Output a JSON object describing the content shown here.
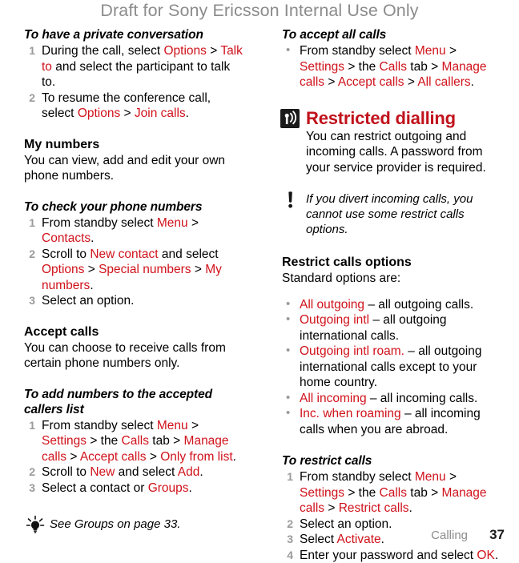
{
  "draft_banner": "Draft for Sony Ericsson Internal Use Only",
  "accent_color": "#d0121b",
  "chapter_color": "#c1121c",
  "muted_color": "#8c8c8c",
  "left_column": {
    "private_conversation": {
      "heading": "To have a private conversation",
      "steps": [
        {
          "parts": [
            {
              "t": "During the call, select ",
              "c": "black"
            },
            {
              "t": "Options",
              "c": "red"
            },
            {
              "t": " > ",
              "c": "black"
            },
            {
              "t": "Talk to",
              "c": "red"
            },
            {
              "t": " and select the participant to talk to.",
              "c": "black"
            }
          ]
        },
        {
          "parts": [
            {
              "t": "To resume the conference call, select ",
              "c": "black"
            },
            {
              "t": "Options",
              "c": "red"
            },
            {
              "t": " > ",
              "c": "black"
            },
            {
              "t": "Join calls",
              "c": "red"
            },
            {
              "t": ".",
              "c": "black"
            }
          ]
        }
      ]
    },
    "my_numbers": {
      "heading": "My numbers",
      "body": "You can view, add and edit your own phone numbers."
    },
    "check_numbers": {
      "heading": "To check your phone numbers",
      "steps": [
        {
          "parts": [
            {
              "t": "From standby select ",
              "c": "black"
            },
            {
              "t": "Menu",
              "c": "red"
            },
            {
              "t": " > ",
              "c": "black"
            },
            {
              "t": "Contacts",
              "c": "red"
            },
            {
              "t": ".",
              "c": "black"
            }
          ]
        },
        {
          "parts": [
            {
              "t": "Scroll to ",
              "c": "black"
            },
            {
              "t": "New contact",
              "c": "red"
            },
            {
              "t": " and select ",
              "c": "black"
            },
            {
              "t": "Options",
              "c": "red"
            },
            {
              "t": " > ",
              "c": "black"
            },
            {
              "t": "Special numbers",
              "c": "red"
            },
            {
              "t": " > ",
              "c": "black"
            },
            {
              "t": "My numbers",
              "c": "red"
            },
            {
              "t": ".",
              "c": "black"
            }
          ]
        },
        {
          "parts": [
            {
              "t": "Select an option.",
              "c": "black"
            }
          ]
        }
      ]
    },
    "accept_calls": {
      "heading": "Accept calls",
      "body": "You can choose to receive calls from certain phone numbers only."
    },
    "add_numbers": {
      "heading": "To add numbers to the accepted callers list",
      "steps": [
        {
          "parts": [
            {
              "t": "From standby select ",
              "c": "black"
            },
            {
              "t": "Menu",
              "c": "red"
            },
            {
              "t": " > ",
              "c": "black"
            },
            {
              "t": "Settings",
              "c": "red"
            },
            {
              "t": " > the ",
              "c": "black"
            },
            {
              "t": "Calls",
              "c": "red"
            },
            {
              "t": " tab > ",
              "c": "black"
            },
            {
              "t": "Manage calls",
              "c": "red"
            },
            {
              "t": " > ",
              "c": "black"
            },
            {
              "t": "Accept calls",
              "c": "red"
            },
            {
              "t": " > ",
              "c": "black"
            },
            {
              "t": "Only from list",
              "c": "red"
            },
            {
              "t": ".",
              "c": "black"
            }
          ]
        },
        {
          "parts": [
            {
              "t": "Scroll to ",
              "c": "black"
            },
            {
              "t": "New",
              "c": "red"
            },
            {
              "t": " and select ",
              "c": "black"
            },
            {
              "t": "Add",
              "c": "red"
            },
            {
              "t": ".",
              "c": "black"
            }
          ]
        },
        {
          "parts": [
            {
              "t": "Select a contact or ",
              "c": "black"
            },
            {
              "t": "Groups",
              "c": "red"
            },
            {
              "t": ".",
              "c": "black"
            }
          ]
        }
      ]
    },
    "tip": {
      "icon": "lightbulb-icon",
      "text": "See Groups on page 33."
    }
  },
  "right_column": {
    "accept_all": {
      "heading": "To accept all calls",
      "bullets": [
        {
          "parts": [
            {
              "t": "From standby select ",
              "c": "black"
            },
            {
              "t": "Menu",
              "c": "red"
            },
            {
              "t": " > ",
              "c": "black"
            },
            {
              "t": "Settings",
              "c": "red"
            },
            {
              "t": " > the ",
              "c": "black"
            },
            {
              "t": "Calls",
              "c": "red"
            },
            {
              "t": " tab > ",
              "c": "black"
            },
            {
              "t": "Manage calls",
              "c": "red"
            },
            {
              "t": " > ",
              "c": "black"
            },
            {
              "t": "Accept calls",
              "c": "red"
            },
            {
              "t": " > ",
              "c": "black"
            },
            {
              "t": "All callers",
              "c": "red"
            },
            {
              "t": ".",
              "c": "black"
            }
          ]
        }
      ]
    },
    "restricted_dialling": {
      "icon": "signal-antenna-icon",
      "title": "Restricted dialling",
      "body": "You can restrict outgoing and incoming calls. A password from your service provider is required."
    },
    "note": {
      "icon": "exclamation-icon",
      "text": "If you divert incoming calls, you cannot use some restrict calls options."
    },
    "restrict_options": {
      "heading": "Restrict calls options",
      "intro": "Standard options are:",
      "items": [
        {
          "parts": [
            {
              "t": "All outgoing",
              "c": "red"
            },
            {
              "t": " – all outgoing calls.",
              "c": "black"
            }
          ]
        },
        {
          "parts": [
            {
              "t": "Outgoing intl",
              "c": "red"
            },
            {
              "t": " – all outgoing international calls.",
              "c": "black"
            }
          ]
        },
        {
          "parts": [
            {
              "t": "Outgoing intl roam.",
              "c": "red"
            },
            {
              "t": " – all outgoing international calls except to your home country.",
              "c": "black"
            }
          ]
        },
        {
          "parts": [
            {
              "t": "All incoming",
              "c": "red"
            },
            {
              "t": " – all incoming calls.",
              "c": "black"
            }
          ]
        },
        {
          "parts": [
            {
              "t": "Inc. when roaming",
              "c": "red"
            },
            {
              "t": " – all incoming calls when you are abroad.",
              "c": "black"
            }
          ]
        }
      ]
    },
    "to_restrict_calls": {
      "heading": "To restrict calls",
      "steps": [
        {
          "parts": [
            {
              "t": "From standby select ",
              "c": "black"
            },
            {
              "t": "Menu",
              "c": "red"
            },
            {
              "t": " > ",
              "c": "black"
            },
            {
              "t": "Settings",
              "c": "red"
            },
            {
              "t": " > the ",
              "c": "black"
            },
            {
              "t": "Calls",
              "c": "red"
            },
            {
              "t": " tab > ",
              "c": "black"
            },
            {
              "t": "Manage calls",
              "c": "red"
            },
            {
              "t": " > ",
              "c": "black"
            },
            {
              "t": "Restrict calls",
              "c": "red"
            },
            {
              "t": ".",
              "c": "black"
            }
          ]
        },
        {
          "parts": [
            {
              "t": "Select an option.",
              "c": "black"
            }
          ]
        },
        {
          "parts": [
            {
              "t": "Select ",
              "c": "black"
            },
            {
              "t": "Activate",
              "c": "red"
            },
            {
              "t": ".",
              "c": "black"
            }
          ]
        },
        {
          "parts": [
            {
              "t": "Enter your password and select ",
              "c": "black"
            },
            {
              "t": "OK",
              "c": "red"
            },
            {
              "t": ".",
              "c": "black"
            }
          ]
        }
      ]
    }
  },
  "footer": {
    "chapter": "Calling",
    "page": "37"
  }
}
